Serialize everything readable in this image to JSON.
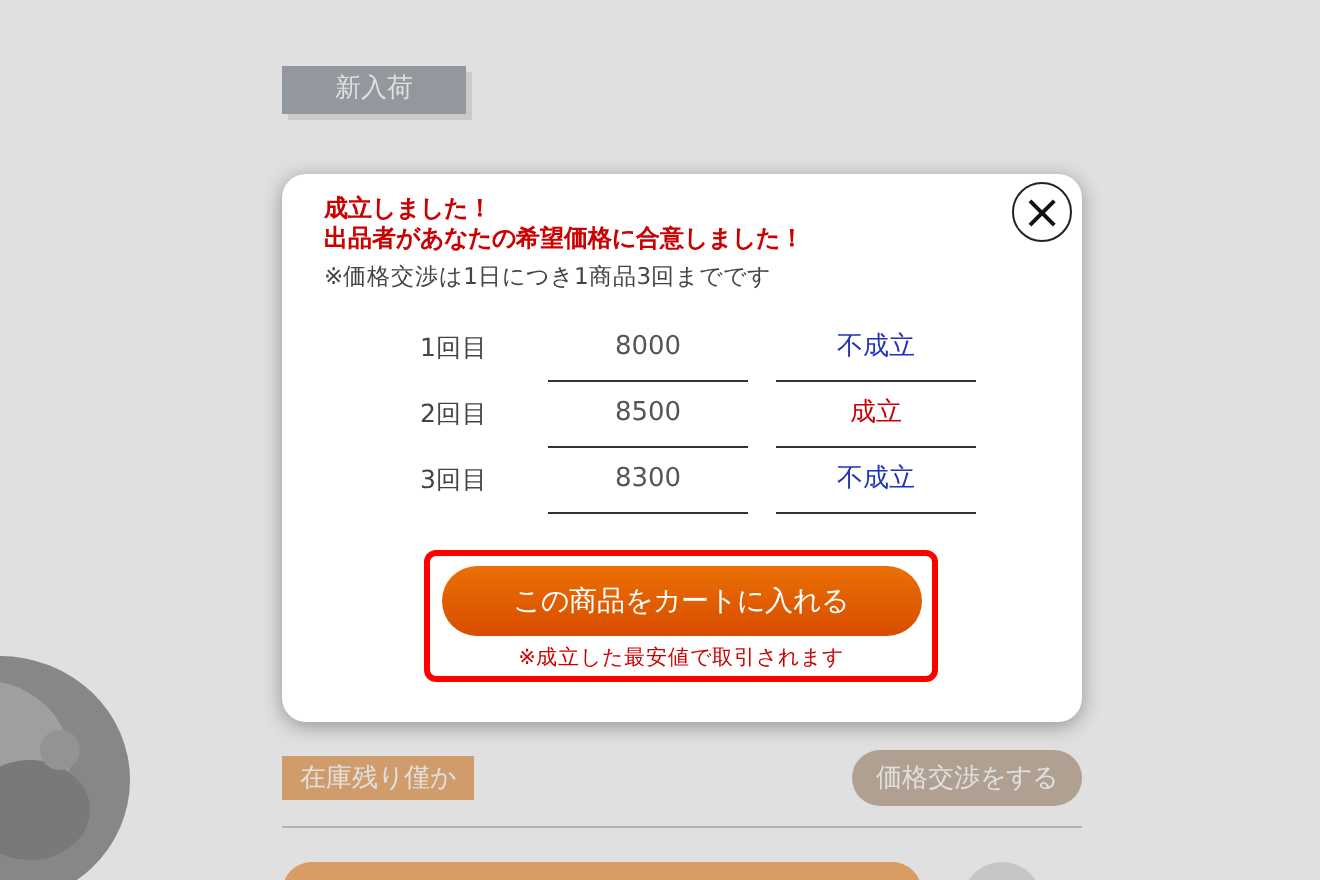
{
  "page": {
    "badge": "新入荷",
    "stock_tag": "在庫残り僅か",
    "negotiate_button": "価格交渉をする"
  },
  "dialog": {
    "close_label": "×",
    "headline": [
      "成立しました！",
      "出品者があなたの希望価格に合意しました！"
    ],
    "note": "※価格交渉は1日につき1商品3回までです",
    "attempts": [
      {
        "label": "1回目",
        "price": "8000",
        "result": "不成立",
        "agreed": false
      },
      {
        "label": "2回目",
        "price": "8500",
        "result": "成立",
        "agreed": true
      },
      {
        "label": "3回目",
        "price": "8300",
        "result": "不成立",
        "agreed": false
      }
    ],
    "cart_button": "この商品をカートに入れる",
    "cart_note": "※成立した最安値で取引されます"
  }
}
